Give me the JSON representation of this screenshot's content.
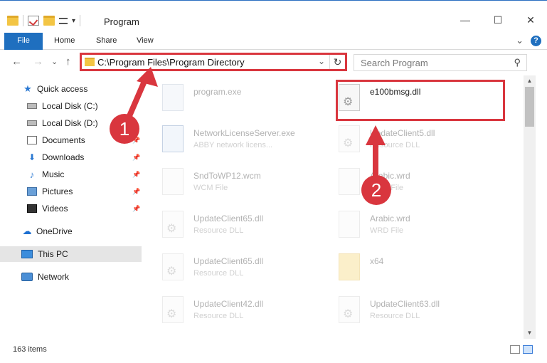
{
  "window": {
    "title": "Program"
  },
  "window_buttons": [
    "—",
    "☐",
    "✕"
  ],
  "ribbon": {
    "tabs": [
      "File",
      "Home",
      "Share",
      "View"
    ],
    "expand_glyph": "⌄",
    "help_glyph": "?"
  },
  "nav": {
    "back": "←",
    "forward": "→",
    "recent": "⌄",
    "up": "↑",
    "address": "C:\\Program Files\\Program Directory",
    "address_chevron": "⌄",
    "refresh": "↻"
  },
  "search": {
    "placeholder": "Search Program",
    "icon": "⚲"
  },
  "sidebar": {
    "items": [
      {
        "label": "Quick access",
        "icon": "star-icon"
      },
      {
        "label": "Local Disk (C:)",
        "icon": "disk-icon"
      },
      {
        "label": "Local Disk (D:)",
        "icon": "disk-icon"
      },
      {
        "label": "Documents",
        "icon": "documents-icon",
        "pinned": true
      },
      {
        "label": "Downloads",
        "icon": "downloads-icon",
        "pinned": true
      },
      {
        "label": "Music",
        "icon": "music-icon",
        "pinned": true
      },
      {
        "label": "Pictures",
        "icon": "pictures-icon",
        "pinned": true
      },
      {
        "label": "Videos",
        "icon": "videos-icon",
        "pinned": true
      },
      {
        "label": "OneDrive",
        "icon": "onedrive-icon"
      },
      {
        "label": "This PC",
        "icon": "pc-icon",
        "selected": true
      },
      {
        "label": "Network",
        "icon": "network-icon"
      }
    ]
  },
  "files": [
    {
      "name": "program.exe",
      "type": "",
      "icon": "exe-icon"
    },
    {
      "name": "e100bmsg.dll",
      "type": "",
      "icon": "dll-icon",
      "highlighted": true
    },
    {
      "name": "NetworkLicenseServer.exe",
      "type": "ABBY network licens...",
      "icon": "app-icon"
    },
    {
      "name": "UpdateClient5.dll",
      "type": "Resource DLL",
      "icon": "dll-icon"
    },
    {
      "name": "SndToWP12.wcm",
      "type": "WCM File",
      "icon": "file-icon"
    },
    {
      "name": "Arabic.wrd",
      "type": "WRD File",
      "icon": "file-icon"
    },
    {
      "name": "UpdateClient65.dll",
      "type": "Resource DLL",
      "icon": "dll-icon"
    },
    {
      "name": "Arabic.wrd",
      "type": "WRD File",
      "icon": "file-icon"
    },
    {
      "name": "UpdateClient65.dll",
      "type": "Resource DLL",
      "icon": "dll-icon"
    },
    {
      "name": "x64",
      "type": "",
      "icon": "folder-icon"
    },
    {
      "name": "UpdateClient42.dll",
      "type": "Resource DLL",
      "icon": "dll-icon"
    },
    {
      "name": "UpdateClient63.dll",
      "type": "Resource DLL",
      "icon": "dll-icon"
    }
  ],
  "annotations": {
    "step1": "1",
    "step2": "2"
  },
  "status": {
    "item_count": "163 items"
  },
  "scroll": {
    "up": "▲",
    "down": "▼"
  },
  "colors": {
    "accent": "#1f6fbf",
    "annotation": "#d9363e",
    "selected_bg": "#e5e5e5"
  }
}
